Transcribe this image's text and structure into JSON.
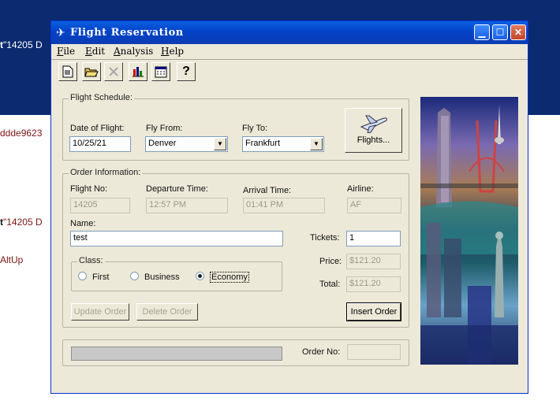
{
  "background": {
    "line1": {
      "lead": "t",
      "quote": "\"14205",
      "tail": " D"
    },
    "line2": "ddde9623",
    "line3": {
      "lead": "t",
      "quote": "\"14205",
      "tail": " D"
    },
    "line4": "AltUp"
  },
  "window": {
    "title": "Flight Reservation",
    "minimize_icon": "minimize-icon",
    "maximize_icon": "maximize-icon",
    "close_icon": "close-icon"
  },
  "menu": [
    {
      "underline": "F",
      "rest": "ile"
    },
    {
      "underline": "E",
      "rest": "dit"
    },
    {
      "underline": "A",
      "rest": "nalysis"
    },
    {
      "underline": "H",
      "rest": "elp"
    }
  ],
  "toolbar": {
    "icons": [
      "new-document-icon",
      "open-folder-icon",
      "delete-x-icon",
      "bar-chart-icon",
      "calendar-icon",
      "help-question-icon"
    ],
    "help_glyph": "?"
  },
  "flight_schedule": {
    "group_label": "Flight Schedule:",
    "date_label": "Date of Flight:",
    "date_value": "10/25/21",
    "from_label": "Fly From:",
    "from_value": "Denver",
    "to_label": "Fly To:",
    "to_value": "Frankfurt",
    "flights_button": "Flights..."
  },
  "order_info": {
    "group_label": "Order Information:",
    "flight_no_label": "Flight No:",
    "flight_no_value": "14205",
    "departure_label": "Departure Time:",
    "departure_value": "12:57 PM",
    "arrival_label": "Arrival Time:",
    "arrival_value": "01:41 PM",
    "airline_label": "Airline:",
    "airline_value": "AF",
    "name_label": "Name:",
    "name_value": "test",
    "tickets_label": "Tickets:",
    "tickets_value": "1",
    "price_label": "Price:",
    "price_value": "$121.20",
    "total_label": "Total:",
    "total_value": "$121.20",
    "class_label": "Class:",
    "class_options": [
      "First",
      "Business",
      "Economy"
    ],
    "class_selected": "Economy",
    "update_button": "Update Order",
    "delete_button": "Delete Order",
    "insert_button": "Insert Order"
  },
  "status": {
    "order_no_label": "Order No:",
    "order_no_value": ""
  }
}
